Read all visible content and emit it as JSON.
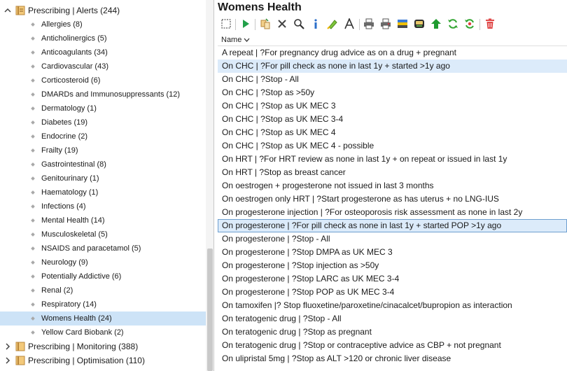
{
  "tree": {
    "parent_open": "Prescribing | Alerts (244)",
    "children": [
      "Allergies (8)",
      "Anticholinergics (5)",
      "Anticoagulants (34)",
      "Cardiovascular (43)",
      "Corticosteroid (6)",
      "DMARDs and Immunosuppressants (12)",
      "Dermatology (1)",
      "Diabetes (19)",
      "Endocrine (2)",
      "Frailty (19)",
      "Gastrointestinal (8)",
      "Genitourinary (1)",
      "Haematology (1)",
      "Infections (4)",
      "Mental Health (14)",
      "Musculoskeletal (5)",
      "NSAIDS and paracetamol (5)",
      "Neurology (9)",
      "Potentially Addictive (6)",
      "Renal (2)",
      "Respiratory (14)",
      "Womens Health (24)",
      "Yellow Card Biobank (2)"
    ],
    "selected_child": "Womens Health (24)",
    "other_parents": [
      "Prescribing | Monitoring (388)",
      "Prescribing | Optimisation (110)"
    ]
  },
  "panel": {
    "title": "Womens Health",
    "column_header": "Name",
    "toolbar_icons": [
      "select-icon",
      "run-icon",
      "copy-icon",
      "delete-x-icon",
      "search-icon",
      "info-icon",
      "highlight-icon",
      "font-icon",
      "print-icon",
      "print-preview-icon",
      "export-icon",
      "database-icon",
      "move-up-icon",
      "refresh-icon",
      "refresh-all-icon",
      "trash-icon"
    ],
    "items": [
      "A repeat | ?For pregnancy drug advice as on a drug + pregnant",
      "On CHC | ?For pill check as none in last 1y + started >1y ago",
      "On CHC | ?Stop - All",
      "On CHC | ?Stop as >50y",
      "On CHC | ?Stop as UK MEC 3",
      "On CHC | ?Stop as UK MEC 3-4",
      "On CHC | ?Stop as UK MEC 4",
      "On CHC | ?Stop as UK MEC 4 - possible",
      "On HRT | ?For HRT review as none in last 1y + on repeat or issued in last 1y",
      "On HRT | ?Stop as breast cancer",
      "On oestrogen + progesterone not issued in last 3 months",
      "On oestrogen only HRT | ?Start progesterone as has uterus + no LNG-IUS",
      "On progesterone injection | ?For osteoporosis risk assessment as none in last 2y",
      "On progesterone | ?For pill check as none in last 1y + started POP >1y ago",
      "On progesterone | ?Stop - All",
      "On progesterone | ?Stop DMPA as UK MEC 3",
      "On progesterone | ?Stop injection as >50y",
      "On progesterone | ?Stop LARC as UK MEC 3-4",
      "On progesterone | ?Stop POP as UK MEC 3-4",
      "On tamoxifen |? Stop fluoxetine/paroxetine/cinacalcet/bupropion as interaction",
      "On teratogenic drug | ?Stop - All",
      "On teratogenic drug | ?Stop as pregnant",
      "On teratogenic drug | ?Stop or contraceptive advice as CBP + not pregnant",
      "On ulipristal 5mg | ?Stop as ALT >120 or chronic liver disease"
    ],
    "hover_item": "On CHC | ?For pill check as none in last 1y + started >1y ago",
    "focused_item": "On progesterone | ?For pill check as none in last 1y + started POP >1y ago"
  }
}
